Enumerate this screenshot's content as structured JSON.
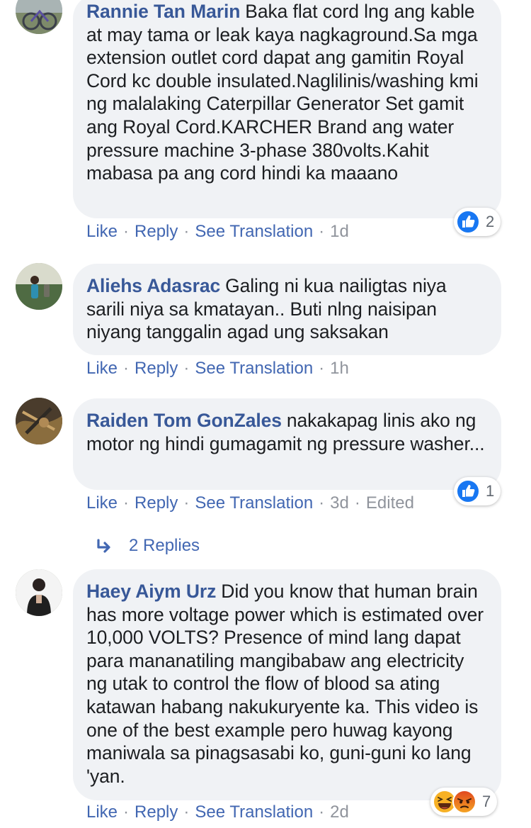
{
  "colors": {
    "author": "#385898",
    "link": "#4267b2",
    "meta": "#90949c",
    "bubble": "#f0f2f5",
    "like_blue": "#1877f2",
    "haha_yellow": "#f7b125",
    "angry_orange": "#e9710f"
  },
  "comments": [
    {
      "author": "Rannie Tan Marin",
      "text": "Baka flat cord lng ang kable at may tama or leak kaya nagkaground.Sa mga extension outlet cord dapat ang gamitin Royal Cord kc double insulated.Naglilinis/washing kmi ng malalaking Caterpillar Generator Set gamit ang Royal Cord.KARCHER Brand ang water pressure machine 3-phase 380volts.Kahit mabasa pa ang cord hindi ka maaano",
      "like": "Like",
      "reply": "Reply",
      "translate": "See Translation",
      "time": "1d",
      "reactions": {
        "icons": [
          "like-icon"
        ],
        "count": "2"
      }
    },
    {
      "author": "Aliehs Adasrac",
      "text": "Galing ni kua nailigtas niya sarili niya sa kmatayan.. Buti nlng naisipan niyang tanggalin agad ung saksakan",
      "like": "Like",
      "reply": "Reply",
      "translate": "See Translation",
      "time": "1h"
    },
    {
      "author": "Raiden Tom GonZales",
      "text": "nakakapag linis ako ng motor ng hindi gumagamit ng pressure washer...",
      "like": "Like",
      "reply": "Reply",
      "translate": "See Translation",
      "time": "3d",
      "edited": "Edited",
      "reactions": {
        "icons": [
          "like-icon"
        ],
        "count": "1"
      },
      "replies_label": "2 Replies"
    },
    {
      "author": "Haey Aiym Urz",
      "text": "Did you know that human brain has more voltage power which is estimated over 10,000 VOLTS? Presence of mind lang dapat para mananatiling mangibabaw ang electricity ng utak to control the flow of blood sa ating katawan habang nakukuryente ka. This video is one of the best example pero huwag kayong maniwala sa pinagsasabi ko, guni-guni ko lang 'yan.",
      "like": "Like",
      "reply": "Reply",
      "translate": "See Translation",
      "time": "2d",
      "reactions": {
        "icons": [
          "haha-icon",
          "angry-icon"
        ],
        "count": "7"
      }
    }
  ]
}
